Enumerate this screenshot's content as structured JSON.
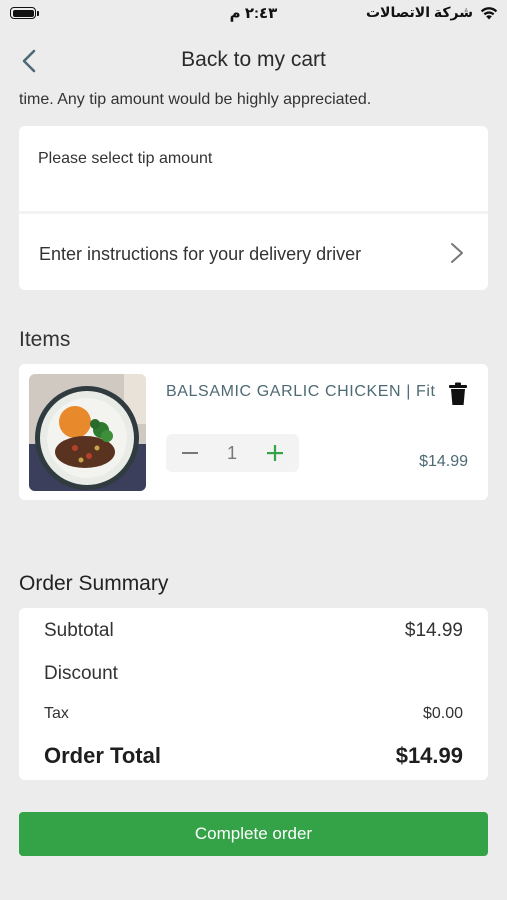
{
  "status_bar": {
    "time": "٢:٤٣ م",
    "carrier": "شركة الاتصالات"
  },
  "nav": {
    "title": "Back to my cart",
    "back_icon": "chevron-left-icon"
  },
  "tip": {
    "note": "time. Any tip amount would be highly appreciated.",
    "select_label": "Please select tip amount"
  },
  "instructions": {
    "label": "Enter instructions for your delivery driver",
    "icon": "chevron-right-icon"
  },
  "items_section": {
    "title": "Items",
    "items": [
      {
        "name": "BALSAMIC GARLIC CHICKEN | Fit",
        "quantity": "1",
        "price": "$14.99"
      }
    ]
  },
  "summary": {
    "title": "Order Summary",
    "subtotal_label": "Subtotal",
    "subtotal_value": "$14.99",
    "discount_label": "Discount",
    "tax_label": "Tax",
    "tax_value": "$0.00",
    "total_label": "Order Total",
    "total_value": "$14.99"
  },
  "actions": {
    "complete_label": "Complete order"
  },
  "colors": {
    "accent": "#34a247",
    "background": "#ececec",
    "item_text": "#4e6a74"
  }
}
